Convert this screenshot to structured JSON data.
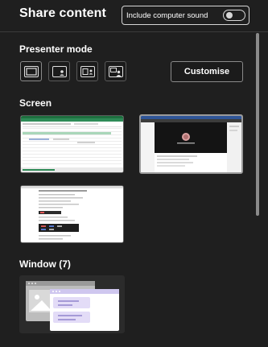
{
  "header": {
    "title": "Share content",
    "sound_toggle_label": "Include computer sound"
  },
  "presenter_mode": {
    "label": "Presenter mode",
    "modes": [
      {
        "name": "content-only",
        "icon": "content-only-icon"
      },
      {
        "name": "standout",
        "icon": "standout-icon"
      },
      {
        "name": "side-by-side",
        "icon": "side-by-side-icon"
      },
      {
        "name": "reporter",
        "icon": "reporter-icon"
      }
    ],
    "customise_label": "Customise"
  },
  "screens": {
    "label": "Screen",
    "items": [
      {
        "name": "screen-1",
        "content": "spreadsheet"
      },
      {
        "name": "screen-2",
        "content": "teams-meeting"
      },
      {
        "name": "screen-3",
        "content": "document"
      }
    ]
  },
  "windows": {
    "label": "Window (7)"
  },
  "colors": {
    "background": "#1f1f1f",
    "border": "#5a5a5a",
    "text": "#ffffff",
    "window_accent": "#e3dcf7"
  }
}
